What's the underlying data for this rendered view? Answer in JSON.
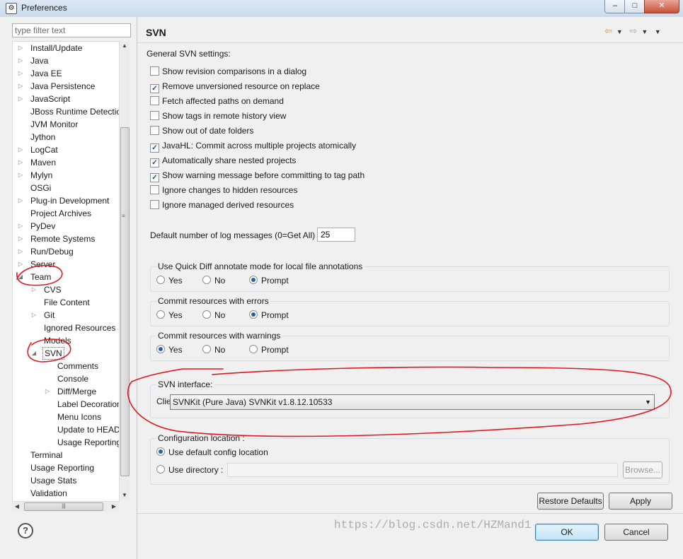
{
  "window": {
    "title": "Preferences",
    "minimize": "–",
    "maximize": "□",
    "close": "✕"
  },
  "filter": {
    "placeholder": "type filter text"
  },
  "tree": {
    "items": [
      {
        "label": "Install/Update",
        "depth": 0,
        "expander": "collapsed"
      },
      {
        "label": "Java",
        "depth": 0,
        "expander": "collapsed"
      },
      {
        "label": "Java EE",
        "depth": 0,
        "expander": "collapsed"
      },
      {
        "label": "Java Persistence",
        "depth": 0,
        "expander": "collapsed"
      },
      {
        "label": "JavaScript",
        "depth": 0,
        "expander": "collapsed"
      },
      {
        "label": "JBoss Runtime Detection",
        "depth": 0,
        "expander": "none"
      },
      {
        "label": "JVM Monitor",
        "depth": 0,
        "expander": "none"
      },
      {
        "label": "Jython",
        "depth": 0,
        "expander": "none"
      },
      {
        "label": "LogCat",
        "depth": 0,
        "expander": "collapsed"
      },
      {
        "label": "Maven",
        "depth": 0,
        "expander": "collapsed"
      },
      {
        "label": "Mylyn",
        "depth": 0,
        "expander": "collapsed"
      },
      {
        "label": "OSGi",
        "depth": 0,
        "expander": "none"
      },
      {
        "label": "Plug-in Development",
        "depth": 0,
        "expander": "collapsed"
      },
      {
        "label": "Project Archives",
        "depth": 0,
        "expander": "none"
      },
      {
        "label": "PyDev",
        "depth": 0,
        "expander": "collapsed"
      },
      {
        "label": "Remote Systems",
        "depth": 0,
        "expander": "collapsed"
      },
      {
        "label": "Run/Debug",
        "depth": 0,
        "expander": "collapsed"
      },
      {
        "label": "Server",
        "depth": 0,
        "expander": "collapsed"
      },
      {
        "label": "Team",
        "depth": 0,
        "expander": "expanded"
      },
      {
        "label": "CVS",
        "depth": 1,
        "expander": "collapsed"
      },
      {
        "label": "File Content",
        "depth": 1,
        "expander": "none"
      },
      {
        "label": "Git",
        "depth": 1,
        "expander": "collapsed"
      },
      {
        "label": "Ignored Resources",
        "depth": 1,
        "expander": "none"
      },
      {
        "label": "Models",
        "depth": 1,
        "expander": "none"
      },
      {
        "label": "SVN",
        "depth": 1,
        "expander": "expanded",
        "selected": true
      },
      {
        "label": "Comments",
        "depth": 2,
        "expander": "none"
      },
      {
        "label": "Console",
        "depth": 2,
        "expander": "none"
      },
      {
        "label": "Diff/Merge",
        "depth": 2,
        "expander": "collapsed"
      },
      {
        "label": "Label Decorations",
        "depth": 2,
        "expander": "none"
      },
      {
        "label": "Menu Icons",
        "depth": 2,
        "expander": "none"
      },
      {
        "label": "Update to HEAD",
        "depth": 2,
        "expander": "none"
      },
      {
        "label": "Usage Reporting",
        "depth": 2,
        "expander": "none"
      },
      {
        "label": "Terminal",
        "depth": 0,
        "expander": "none"
      },
      {
        "label": "Usage Reporting",
        "depth": 0,
        "expander": "none"
      },
      {
        "label": "Usage Stats",
        "depth": 0,
        "expander": "none"
      },
      {
        "label": "Validation",
        "depth": 0,
        "expander": "none"
      }
    ]
  },
  "page": {
    "title": "SVN",
    "general_label": "General SVN settings:",
    "checkboxes": [
      {
        "label": "Show revision comparisons in a dialog",
        "checked": false
      },
      {
        "label": "Remove unversioned resource on replace",
        "checked": true
      },
      {
        "label": "Fetch affected paths on demand",
        "checked": false
      },
      {
        "label": "Show tags in remote history view",
        "checked": false
      },
      {
        "label": "Show out of date folders",
        "checked": false
      },
      {
        "label": "JavaHL: Commit across multiple projects atomically",
        "checked": true
      },
      {
        "label": "Automatically share nested projects",
        "checked": true
      },
      {
        "label": "Show warning message before committing to tag path",
        "checked": true
      },
      {
        "label": "Ignore changes to hidden resources",
        "checked": false
      },
      {
        "label": "Ignore managed derived resources",
        "checked": false
      }
    ],
    "log_messages_label": "Default number of log messages (0=Get All)",
    "log_messages_value": "25",
    "groups": [
      {
        "label": "Use Quick Diff annotate mode for local file annotations",
        "options": [
          "Yes",
          "No",
          "Prompt"
        ],
        "selected": "Prompt"
      },
      {
        "label": "Commit resources with errors",
        "options": [
          "Yes",
          "No",
          "Prompt"
        ],
        "selected": "Prompt"
      },
      {
        "label": "Commit resources with warnings",
        "options": [
          "Yes",
          "No",
          "Prompt"
        ],
        "selected": "Yes"
      }
    ],
    "svn_interface": {
      "label": "SVN interface:",
      "client_label": "Client:",
      "client_value": "SVNKit (Pure Java) SVNKit v1.8.12.10533"
    },
    "config": {
      "label": "Configuration location :",
      "default_option": "Use default config location",
      "dir_option": "Use directory :",
      "selected": "default",
      "browse": "Browse..."
    },
    "restore_defaults": "Restore Defaults",
    "apply": "Apply"
  },
  "dialog": {
    "ok": "OK",
    "cancel": "Cancel",
    "help": "?"
  },
  "watermark": "https://blog.csdn.net/HZMand1",
  "annotation_color": "#e0191e"
}
